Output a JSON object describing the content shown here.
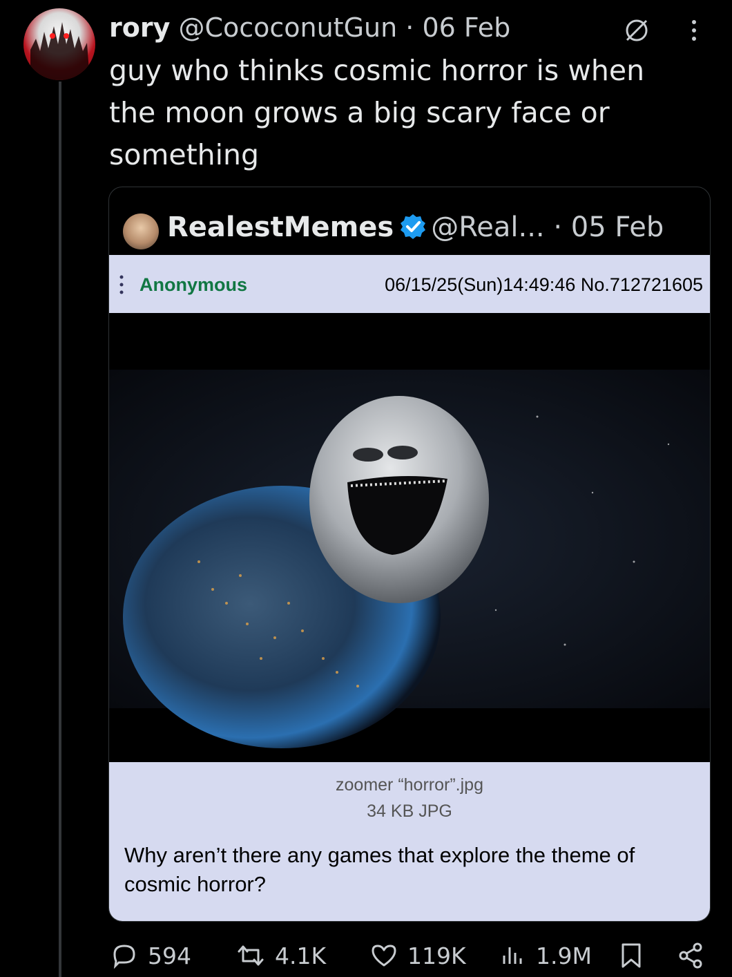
{
  "tweet": {
    "name": "rory",
    "handle": "@CococonutGun",
    "separator": "·",
    "date": "06 Feb",
    "text": "guy who thinks cosmic horror is when the moon grows a big scary face or something",
    "icons": [
      "avatar",
      "verified-outline-icon",
      "more-icon"
    ]
  },
  "quote": {
    "name": "RealestMemes",
    "handle": "@Real...",
    "separator": "·",
    "date": "05 Feb",
    "icons": [
      "avatar",
      "verified-badge-icon"
    ],
    "post": {
      "poster": "Anonymous",
      "meta": "06/15/25(Sun)14:49:46 No.712721605",
      "filename": "zoomer “horror”.jpg",
      "filesize": "34 KB JPG",
      "comment": "Why aren’t there any games that explore the theme of cosmic horror?"
    }
  },
  "actions": {
    "replies": "594",
    "reposts": "4.1K",
    "likes": "119K",
    "views": "1.9M"
  },
  "colors": {
    "background": "#000000",
    "text": "#e7e9ea",
    "muted": "#c8ccd0",
    "verified": "#1d9bf0",
    "post_bg": "#d6daf0",
    "poster_green": "#117743"
  }
}
